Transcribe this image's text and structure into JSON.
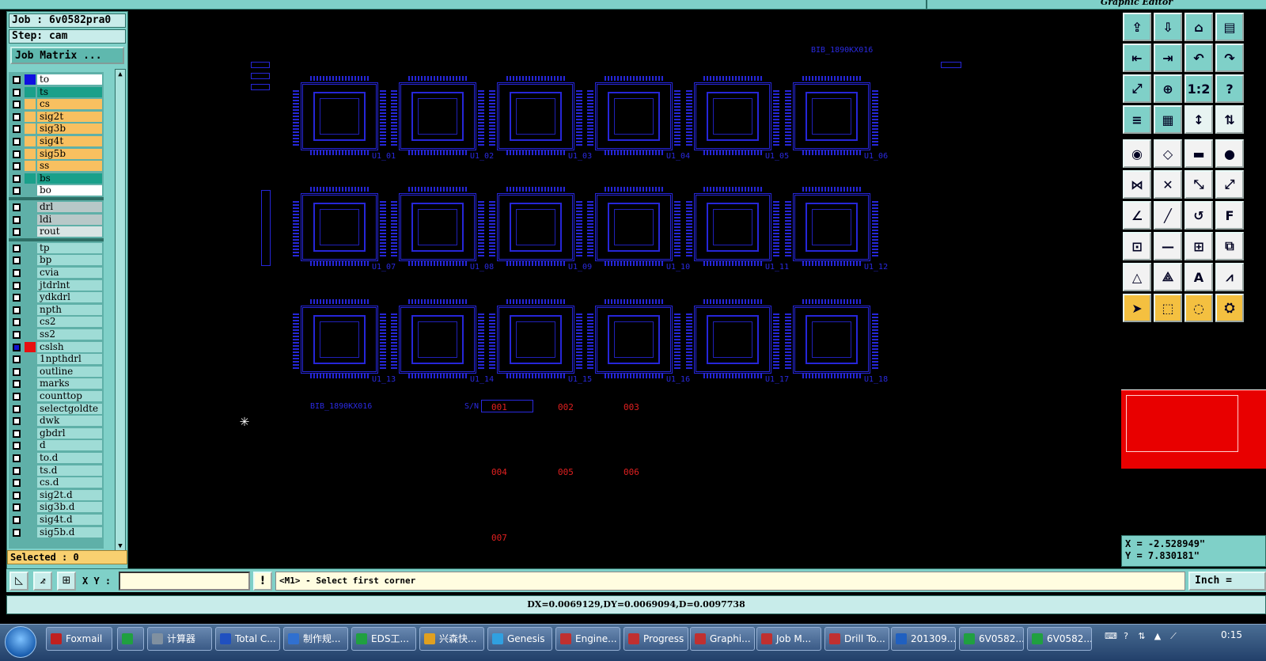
{
  "window": {
    "title": "Graphic Editor"
  },
  "job": {
    "job_label": "Job : 6v0582pra0",
    "step_label": "Step: cam",
    "matrix_button": "Job Matrix ..."
  },
  "layers": [
    {
      "name": "to",
      "color": "#ffffff",
      "swatch": "#1010e0",
      "active": false
    },
    {
      "name": "ts",
      "color": "#1aa08a",
      "swatch": "#1aa08a",
      "active": false
    },
    {
      "name": "cs",
      "color": "#f8c060",
      "swatch": "#f8c060",
      "active": false
    },
    {
      "name": "sig2t",
      "color": "#f8c060",
      "swatch": "#f8c060",
      "active": false
    },
    {
      "name": "sig3b",
      "color": "#f8c060",
      "swatch": "#f8c060",
      "active": false
    },
    {
      "name": "sig4t",
      "color": "#f8c060",
      "swatch": "#f8c060",
      "active": false
    },
    {
      "name": "sig5b",
      "color": "#f8c060",
      "swatch": "#f8c060",
      "active": false
    },
    {
      "name": "ss",
      "color": "#f8c060",
      "swatch": "#f8c060",
      "active": false
    },
    {
      "name": "bs",
      "color": "#1aa08a",
      "swatch": "#1aa08a",
      "active": false
    },
    {
      "name": "bo",
      "color": "#ffffff",
      "swatch": "#5fb0a8",
      "active": false
    },
    {
      "name": "drl",
      "color": "#b8c8c8",
      "swatch": "#5fb0a8",
      "active": false
    },
    {
      "name": "ldi",
      "color": "#b8c8c8",
      "swatch": "#5fb0a8",
      "active": false
    },
    {
      "name": "rout",
      "color": "#d8e4e4",
      "swatch": "#5fb0a8",
      "active": false
    },
    {
      "name": "tp",
      "color": "#9fdcd6",
      "swatch": "#5fb0a8",
      "active": false
    },
    {
      "name": "bp",
      "color": "#9fdcd6",
      "swatch": "#5fb0a8",
      "active": false
    },
    {
      "name": "cvia",
      "color": "#9fdcd6",
      "swatch": "#5fb0a8",
      "active": false
    },
    {
      "name": "jtdrlnt",
      "color": "#9fdcd6",
      "swatch": "#5fb0a8",
      "active": false
    },
    {
      "name": "ydkdrl",
      "color": "#9fdcd6",
      "swatch": "#5fb0a8",
      "active": false
    },
    {
      "name": "npth",
      "color": "#9fdcd6",
      "swatch": "#5fb0a8",
      "active": false
    },
    {
      "name": "cs2",
      "color": "#9fdcd6",
      "swatch": "#5fb0a8",
      "active": false
    },
    {
      "name": "ss2",
      "color": "#9fdcd6",
      "swatch": "#5fb0a8",
      "active": false
    },
    {
      "name": "cslsh",
      "color": "#9fdcd6",
      "swatch": "#e81010",
      "active": true
    },
    {
      "name": "1npthdrl",
      "color": "#9fdcd6",
      "swatch": "#5fb0a8",
      "active": false
    },
    {
      "name": "outline",
      "color": "#9fdcd6",
      "swatch": "#5fb0a8",
      "active": false
    },
    {
      "name": "marks",
      "color": "#9fdcd6",
      "swatch": "#5fb0a8",
      "active": false
    },
    {
      "name": "counttop",
      "color": "#9fdcd6",
      "swatch": "#5fb0a8",
      "active": false
    },
    {
      "name": "selectgoldte",
      "color": "#9fdcd6",
      "swatch": "#5fb0a8",
      "active": false
    },
    {
      "name": "dwk",
      "color": "#9fdcd6",
      "swatch": "#5fb0a8",
      "active": false
    },
    {
      "name": "gbdrl",
      "color": "#9fdcd6",
      "swatch": "#5fb0a8",
      "active": false
    },
    {
      "name": "d",
      "color": "#9fdcd6",
      "swatch": "#5fb0a8",
      "active": false
    },
    {
      "name": "to.d",
      "color": "#9fdcd6",
      "swatch": "#5fb0a8",
      "active": false
    },
    {
      "name": "ts.d",
      "color": "#9fdcd6",
      "swatch": "#5fb0a8",
      "active": false
    },
    {
      "name": "cs.d",
      "color": "#9fdcd6",
      "swatch": "#5fb0a8",
      "active": false
    },
    {
      "name": "sig2t.d",
      "color": "#9fdcd6",
      "swatch": "#5fb0a8",
      "active": false
    },
    {
      "name": "sig3b.d",
      "color": "#9fdcd6",
      "swatch": "#5fb0a8",
      "active": false
    },
    {
      "name": "sig4t.d",
      "color": "#9fdcd6",
      "swatch": "#5fb0a8",
      "active": false
    },
    {
      "name": "sig5b.d",
      "color": "#9fdcd6",
      "swatch": "#5fb0a8",
      "active": false
    }
  ],
  "selected": "Selected : 0",
  "canvas": {
    "board_label_top": "BIB_1890KX016",
    "board_label_bottom": "BIB_1890KX016",
    "sn_label": "S/N",
    "modules": [
      "U1_01",
      "U1_02",
      "U1_03",
      "U1_04",
      "U1_05",
      "U1_06",
      "U1_07",
      "U1_08",
      "U1_09",
      "U1_10",
      "U1_11",
      "U1_12",
      "U1_13",
      "U1_14",
      "U1_15",
      "U1_16",
      "U1_17",
      "U1_18"
    ],
    "serials": [
      "001",
      "002",
      "003",
      "004",
      "005",
      "006",
      "007"
    ]
  },
  "tools": [
    "move-to-top-icon",
    "move-down-icon",
    "home-icon",
    "layout-icon",
    "arrow-left-icon",
    "arrow-right-icon",
    "undo-icon",
    "redo-icon",
    "fit-zoom-icon",
    "zoom-center-icon",
    "one-to-two-icon",
    "help-icon",
    "settings-icon",
    "grid-icon",
    "snap-icon",
    "toggle-icon",
    "pad-icon",
    "polygon-icon",
    "ruler-icon",
    "circle-icon",
    "connect-icon",
    "cross-icon",
    "line-join-icon",
    "line-split-icon",
    "angle-icon",
    "slash-icon",
    "arc-icon",
    "text-icon",
    "move-pad-icon",
    "minus-icon",
    "measure-icon",
    "copy-icon",
    "triangle-icon",
    "triangle-line-icon",
    "triangle-a-icon",
    "triangle-slash-icon",
    "select-icon",
    "select-box-icon",
    "select-circle-icon",
    "select-group-icon"
  ],
  "tool_glyphs": [
    "⇪",
    "⇩",
    "⌂",
    "▤",
    "⇤",
    "⇥",
    "↶",
    "↷",
    "⤢",
    "⊕",
    "1:2",
    "?",
    "≡",
    "▦",
    "↕",
    "⇅",
    "◉",
    "◇",
    "▬",
    "●",
    "⋈",
    "✕",
    "⤡",
    "⤢",
    "∠",
    "╱",
    "↺",
    "F",
    "⊡",
    "—",
    "⊞",
    "⧉",
    "△",
    "⟁",
    "A",
    "⩘",
    "➤",
    "⬚",
    "◌",
    "⛭"
  ],
  "coordinates": {
    "x": "X = -2.528949\"",
    "y": "Y = 7.830181\""
  },
  "bottom": {
    "xy_label": "X Y :",
    "xy_value": "",
    "prompt": "<M1> - Select first corner",
    "units": "Inch ="
  },
  "status": "DX=0.0069129,DY=0.0069094,D=0.0097738",
  "taskbar": {
    "items": [
      {
        "label": "Foxmail",
        "color": "#c02020"
      },
      {
        "label": "",
        "color": "#20a040"
      },
      {
        "label": "计算器",
        "color": "#8090a0"
      },
      {
        "label": "Total C...",
        "color": "#2050c0"
      },
      {
        "label": "制作规...",
        "color": "#3070d0"
      },
      {
        "label": "EDS工...",
        "color": "#20a040"
      },
      {
        "label": "兴森快...",
        "color": "#e0a020"
      },
      {
        "label": "Genesis",
        "color": "#30a0e0"
      },
      {
        "label": "Engine...",
        "color": "#c03030"
      },
      {
        "label": "Progress",
        "color": "#c03030"
      },
      {
        "label": "Graphi...",
        "color": "#c03030"
      },
      {
        "label": "Job M...",
        "color": "#c03030"
      },
      {
        "label": "Drill To...",
        "color": "#c03030"
      },
      {
        "label": "201309...",
        "color": "#2060c0"
      },
      {
        "label": "6V0582...",
        "color": "#20a040"
      },
      {
        "label": "6V0582...",
        "color": "#20a040"
      }
    ],
    "time": "0:15"
  }
}
